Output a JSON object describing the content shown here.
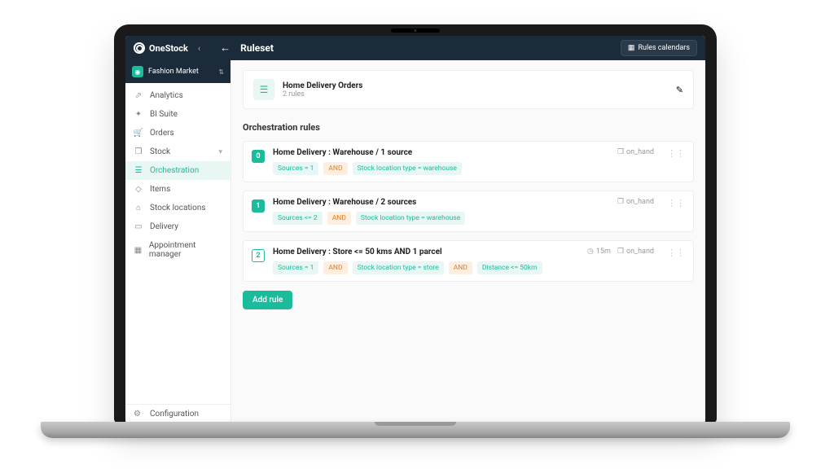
{
  "brand": "OneStock",
  "header": {
    "page_title": "Ruleset",
    "calendar_button": "Rules calendars"
  },
  "tenant": {
    "name": "Fashion Market"
  },
  "sidebar": {
    "items": [
      {
        "label": "Analytics",
        "icon": "analytics"
      },
      {
        "label": "BI Suite",
        "icon": "chart"
      },
      {
        "label": "Orders",
        "icon": "cart"
      },
      {
        "label": "Stock",
        "icon": "cube",
        "expandable": true
      },
      {
        "label": "Orchestration",
        "icon": "list",
        "active": true
      },
      {
        "label": "Items",
        "icon": "tag"
      },
      {
        "label": "Stock locations",
        "icon": "store"
      },
      {
        "label": "Delivery",
        "icon": "truck"
      },
      {
        "label": "Appointment manager",
        "icon": "calendar"
      }
    ],
    "footer": {
      "label": "Configuration"
    }
  },
  "ruleset": {
    "title": "Home Delivery Orders",
    "subtitle": "2 rules"
  },
  "section_title": "Orchestration rules",
  "rules": [
    {
      "index": "0",
      "title": "Home Delivery : Warehouse / 1 source",
      "tags": [
        {
          "text": "Sources = 1",
          "type": "teal"
        },
        {
          "text": "AND",
          "type": "orange"
        },
        {
          "text": "Stock location type = warehouse",
          "type": "teal"
        }
      ],
      "meta": [
        {
          "icon": "cube",
          "text": "on_hand"
        }
      ]
    },
    {
      "index": "1",
      "title": "Home Delivery : Warehouse / 2 sources",
      "tags": [
        {
          "text": "Sources <= 2",
          "type": "teal"
        },
        {
          "text": "AND",
          "type": "orange"
        },
        {
          "text": "Stock location type = warehouse",
          "type": "teal"
        }
      ],
      "meta": [
        {
          "icon": "cube",
          "text": "on_hand"
        }
      ]
    },
    {
      "index": "2",
      "title": "Home Delivery : Store <= 50 kms AND 1 parcel",
      "tags": [
        {
          "text": "Sources = 1",
          "type": "teal"
        },
        {
          "text": "AND",
          "type": "orange"
        },
        {
          "text": "Stock location type = store",
          "type": "teal"
        },
        {
          "text": "AND",
          "type": "orange"
        },
        {
          "text": "Distance <= 50km",
          "type": "teal"
        }
      ],
      "meta": [
        {
          "icon": "clock",
          "text": "15m"
        },
        {
          "icon": "cube",
          "text": "on_hand"
        }
      ]
    }
  ],
  "add_rule_label": "Add rule"
}
